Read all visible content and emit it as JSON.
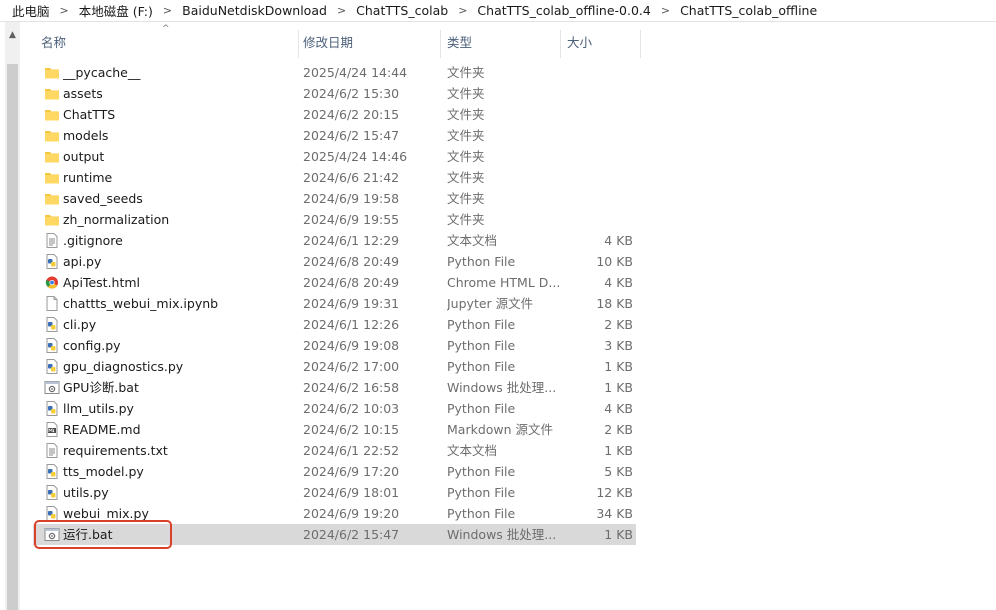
{
  "breadcrumb": [
    "此电脑",
    "本地磁盘 (F:)",
    "BaiduNetdiskDownload",
    "ChatTTS_colab",
    "ChatTTS_colab_offline-0.0.4",
    "ChatTTS_colab_offline"
  ],
  "breadcrumb_separator": ">",
  "columns": {
    "name": "名称",
    "date": "修改日期",
    "type": "类型",
    "size": "大小"
  },
  "sort_indicator": "^",
  "files": [
    {
      "name": "__pycache__",
      "date": "2025/4/24 14:44",
      "type": "文件夹",
      "size": "",
      "icon": "folder-icon"
    },
    {
      "name": "assets",
      "date": "2024/6/2 15:30",
      "type": "文件夹",
      "size": "",
      "icon": "folder-icon"
    },
    {
      "name": "ChatTTS",
      "date": "2024/6/2 20:15",
      "type": "文件夹",
      "size": "",
      "icon": "folder-icon"
    },
    {
      "name": "models",
      "date": "2024/6/2 15:47",
      "type": "文件夹",
      "size": "",
      "icon": "folder-icon"
    },
    {
      "name": "output",
      "date": "2025/4/24 14:46",
      "type": "文件夹",
      "size": "",
      "icon": "folder-icon"
    },
    {
      "name": "runtime",
      "date": "2024/6/6 21:42",
      "type": "文件夹",
      "size": "",
      "icon": "folder-icon"
    },
    {
      "name": "saved_seeds",
      "date": "2024/6/9 19:58",
      "type": "文件夹",
      "size": "",
      "icon": "folder-icon"
    },
    {
      "name": "zh_normalization",
      "date": "2024/6/9 19:55",
      "type": "文件夹",
      "size": "",
      "icon": "folder-icon"
    },
    {
      "name": ".gitignore",
      "date": "2024/6/1 12:29",
      "type": "文本文档",
      "size": "4 KB",
      "icon": "text-file-icon"
    },
    {
      "name": "api.py",
      "date": "2024/6/8 20:49",
      "type": "Python File",
      "size": "10 KB",
      "icon": "python-file-icon"
    },
    {
      "name": "ApiTest.html",
      "date": "2024/6/8 20:49",
      "type": "Chrome HTML D...",
      "size": "4 KB",
      "icon": "chrome-html-icon"
    },
    {
      "name": "chattts_webui_mix.ipynb",
      "date": "2024/6/9 19:31",
      "type": "Jupyter 源文件",
      "size": "18 KB",
      "icon": "blank-file-icon"
    },
    {
      "name": "cli.py",
      "date": "2024/6/1 12:26",
      "type": "Python File",
      "size": "2 KB",
      "icon": "python-file-icon"
    },
    {
      "name": "config.py",
      "date": "2024/6/9 19:08",
      "type": "Python File",
      "size": "3 KB",
      "icon": "python-file-icon"
    },
    {
      "name": "gpu_diagnostics.py",
      "date": "2024/6/2 17:00",
      "type": "Python File",
      "size": "1 KB",
      "icon": "python-file-icon"
    },
    {
      "name": "GPU诊断.bat",
      "date": "2024/6/2 16:58",
      "type": "Windows 批处理...",
      "size": "1 KB",
      "icon": "batch-file-icon"
    },
    {
      "name": "llm_utils.py",
      "date": "2024/6/2 10:03",
      "type": "Python File",
      "size": "4 KB",
      "icon": "python-file-icon"
    },
    {
      "name": "README.md",
      "date": "2024/6/2 10:15",
      "type": "Markdown 源文件",
      "size": "2 KB",
      "icon": "markdown-file-icon"
    },
    {
      "name": "requirements.txt",
      "date": "2024/6/1 22:52",
      "type": "文本文档",
      "size": "1 KB",
      "icon": "text-file-icon"
    },
    {
      "name": "tts_model.py",
      "date": "2024/6/9 17:20",
      "type": "Python File",
      "size": "5 KB",
      "icon": "python-file-icon"
    },
    {
      "name": "utils.py",
      "date": "2024/6/9 18:01",
      "type": "Python File",
      "size": "12 KB",
      "icon": "python-file-icon"
    },
    {
      "name": "webui_mix.py",
      "date": "2024/6/9 19:20",
      "type": "Python File",
      "size": "34 KB",
      "icon": "python-file-icon"
    },
    {
      "name": "运行.bat",
      "date": "2024/6/2 15:47",
      "type": "Windows 批处理...",
      "size": "1 KB",
      "icon": "batch-file-icon",
      "selected": true
    }
  ],
  "highlighted_file": "运行.bat",
  "colors": {
    "selection": "#d9d9d9",
    "highlight_box": "#d9412a",
    "folder": "#f5c842",
    "header_text": "#4c607a"
  }
}
